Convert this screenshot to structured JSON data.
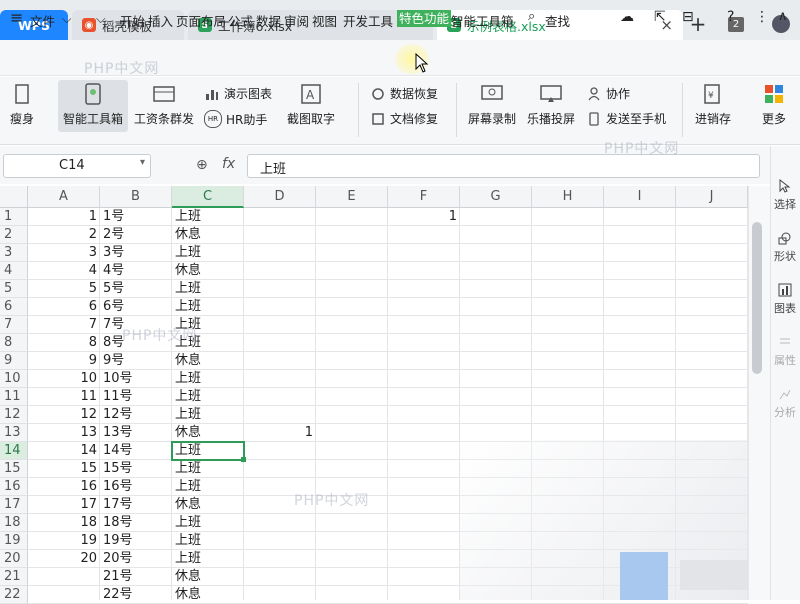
{
  "tabs": {
    "wps_label": "WPS",
    "docer_label": "稻壳模板",
    "book6_label": "工作簿6.xlsx",
    "example_label": "示例表格.xlsx",
    "close_symbol": "×",
    "add_symbol": "+",
    "window_count": "2"
  },
  "menu": {
    "file": "文件",
    "items": [
      "开始",
      "插入",
      "页面布局",
      "公式",
      "数据",
      "审阅",
      "视图",
      "开发工具",
      "特色功能",
      "智能工具箱"
    ],
    "search": "查找"
  },
  "ribbon": {
    "items": [
      "瘦身",
      "智能工具箱",
      "工资条群发",
      "演示图表",
      "HR助手",
      "截图取字",
      "数据恢复",
      "文档修复",
      "屏幕录制",
      "乐播投屏",
      "协作",
      "发送至手机",
      "进销存",
      "更多"
    ]
  },
  "formula_bar": {
    "name_box": "C14",
    "fx_label": "fx",
    "value": "上班"
  },
  "columns": [
    "A",
    "B",
    "C",
    "D",
    "E",
    "F",
    "G",
    "H",
    "I",
    "J"
  ],
  "rows": [
    {
      "n": "1",
      "a": "1",
      "b": "1号",
      "c": "上班",
      "d": "",
      "f": "1"
    },
    {
      "n": "2",
      "a": "2",
      "b": "2号",
      "c": "休息",
      "d": "",
      "f": ""
    },
    {
      "n": "3",
      "a": "3",
      "b": "3号",
      "c": "上班",
      "d": "",
      "f": ""
    },
    {
      "n": "4",
      "a": "4",
      "b": "4号",
      "c": "休息",
      "d": "",
      "f": ""
    },
    {
      "n": "5",
      "a": "5",
      "b": "5号",
      "c": "上班",
      "d": "",
      "f": ""
    },
    {
      "n": "6",
      "a": "6",
      "b": "6号",
      "c": "上班",
      "d": "",
      "f": ""
    },
    {
      "n": "7",
      "a": "7",
      "b": "7号",
      "c": "上班",
      "d": "",
      "f": ""
    },
    {
      "n": "8",
      "a": "8",
      "b": "8号",
      "c": "上班",
      "d": "",
      "f": ""
    },
    {
      "n": "9",
      "a": "9",
      "b": "9号",
      "c": "休息",
      "d": "",
      "f": ""
    },
    {
      "n": "10",
      "a": "10",
      "b": "10号",
      "c": "上班",
      "d": "",
      "f": ""
    },
    {
      "n": "11",
      "a": "11",
      "b": "11号",
      "c": "上班",
      "d": "",
      "f": ""
    },
    {
      "n": "12",
      "a": "12",
      "b": "12号",
      "c": "上班",
      "d": "",
      "f": ""
    },
    {
      "n": "13",
      "a": "13",
      "b": "13号",
      "c": "休息",
      "d": "1",
      "f": ""
    },
    {
      "n": "14",
      "a": "14",
      "b": "14号",
      "c": "上班",
      "d": "",
      "f": ""
    },
    {
      "n": "15",
      "a": "15",
      "b": "15号",
      "c": "上班",
      "d": "",
      "f": ""
    },
    {
      "n": "16",
      "a": "16",
      "b": "16号",
      "c": "上班",
      "d": "",
      "f": ""
    },
    {
      "n": "17",
      "a": "17",
      "b": "17号",
      "c": "休息",
      "d": "",
      "f": ""
    },
    {
      "n": "18",
      "a": "18",
      "b": "18号",
      "c": "上班",
      "d": "",
      "f": ""
    },
    {
      "n": "19",
      "a": "19",
      "b": "19号",
      "c": "上班",
      "d": "",
      "f": ""
    },
    {
      "n": "20",
      "a": "20",
      "b": "20号",
      "c": "上班",
      "d": "",
      "f": ""
    },
    {
      "n": "21",
      "a": "",
      "b": "21号",
      "c": "休息",
      "d": "",
      "f": ""
    },
    {
      "n": "22",
      "a": "",
      "b": "22号",
      "c": "休息",
      "d": "",
      "f": ""
    }
  ],
  "selected_row": "14",
  "selected_col": "C",
  "right_pane": [
    "选择",
    "形状",
    "图表",
    "属性",
    "分析"
  ],
  "watermark": "PHP中文网",
  "colors": {
    "accent": "#2e9c57",
    "wps_blue": "#1e86ff"
  }
}
